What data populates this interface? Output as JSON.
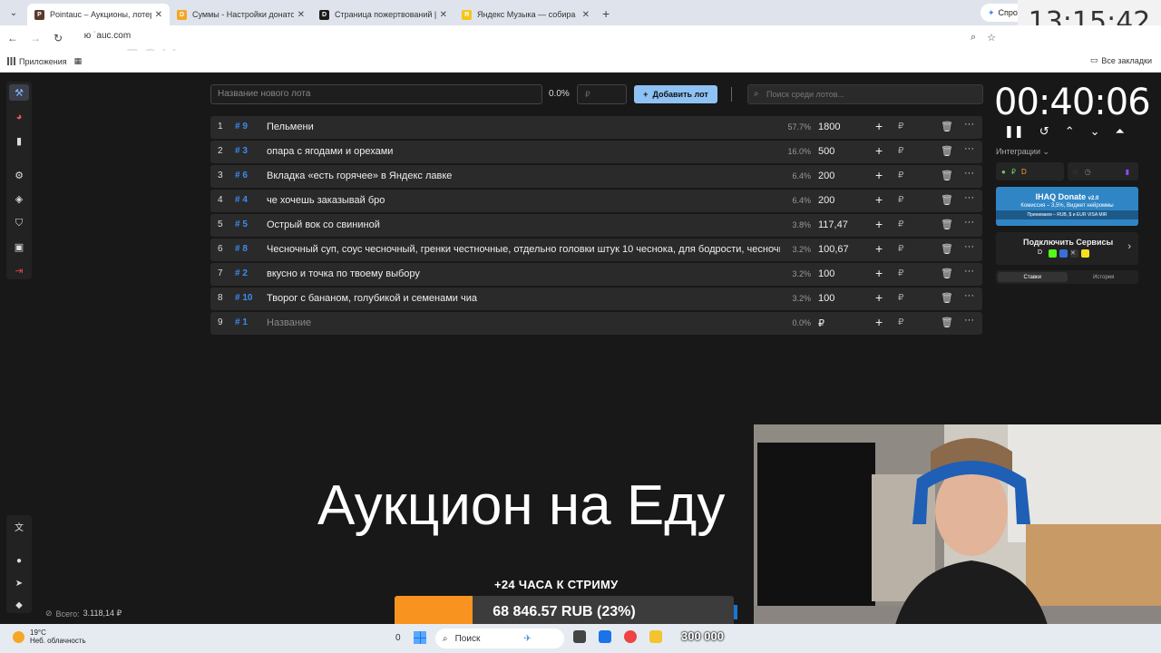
{
  "browser": {
    "tabs": [
      {
        "title": "Pointauc – Аукционы, лотерея",
        "active": true,
        "color": "#5a3a2a",
        "glyph": "P"
      },
      {
        "title": "Суммы - Настройки донатов",
        "active": false,
        "color": "#f5a623",
        "glyph": "D"
      },
      {
        "title": "Страница пожертвований | D",
        "active": false,
        "color": "#1b1b1b",
        "glyph": "D"
      },
      {
        "title": "Яндекс Музыка — собира",
        "active": false,
        "color": "#f5c518",
        "glyph": "Я"
      }
    ],
    "ask_label": "Спрос",
    "url": " ю ˙аuc.com",
    "url_overlay": "...дец..........",
    "bookmarks_apps": "Приложения",
    "bookmarks_all": "Все закладки"
  },
  "clock_overlay": "13:15:42",
  "toolbar": {
    "lot_placeholder": "Название нового лота",
    "percent": "0.0%",
    "amount_placeholder": "₽",
    "add_button": "Добавить лот",
    "search_placeholder": "Поиск среди лотов..."
  },
  "lots": [
    {
      "num": "1",
      "id": "# 9",
      "name": "Пельмени",
      "percent": "57.7%",
      "amount": "1800"
    },
    {
      "num": "2",
      "id": "# 3",
      "name": "опара с ягодами и орехами",
      "percent": "16.0%",
      "amount": "500"
    },
    {
      "num": "3",
      "id": "# 6",
      "name": "Вкладка «есть горячее» в Яндекс лавке",
      "percent": "6.4%",
      "amount": "200"
    },
    {
      "num": "4",
      "id": "# 4",
      "name": "че хочешь заказывай бро",
      "percent": "6.4%",
      "amount": "200"
    },
    {
      "num": "5",
      "id": "# 5",
      "name": "Острый вок со свининой",
      "percent": "3.8%",
      "amount": "117,47"
    },
    {
      "num": "6",
      "id": "# 8",
      "name": "Чесночный суп, соус чесночный, гренки честночные,  отдельно головки штук 10 чеснока, для бодрости, чесночны",
      "percent": "3.2%",
      "amount": "100,67"
    },
    {
      "num": "7",
      "id": "# 2",
      "name": "вкусно и точка по твоему выбору",
      "percent": "3.2%",
      "amount": "100"
    },
    {
      "num": "8",
      "id": "# 10",
      "name": "Творог с бананом, голубикой и семенами чиа",
      "percent": "3.2%",
      "amount": "100"
    },
    {
      "num": "9",
      "id": "# 1",
      "name": "Название",
      "percent": "0.0%",
      "amount": "₽"
    }
  ],
  "currency": "₽",
  "total": {
    "label": "Всего:",
    "value": "3.118,14 ₽"
  },
  "timer": "00:40:06",
  "integrations_label": "Интеграции",
  "ihaq": {
    "title": "IHAQ Donate",
    "version": "v2.0",
    "line2": "Комиссия – 3,5%, Виджет нейроммы",
    "line3": "Принимаем – RUB, $ и EUR  VISA  MIR"
  },
  "connect_label": "Подключить Сервисы",
  "stat_tabs": [
    "Ставки",
    "История"
  ],
  "overlay_title": "Аукцион на Еду",
  "stream_text": "+24 ЧАСА К СТРИМУ",
  "progress": {
    "label": "68 846.57 RUB (23%)",
    "fraction": 0.23
  },
  "taskbar": {
    "temp": "19°C",
    "weather": "Неб. облачность",
    "search": "Поиск",
    "zero": "0",
    "counter": "300 000"
  }
}
